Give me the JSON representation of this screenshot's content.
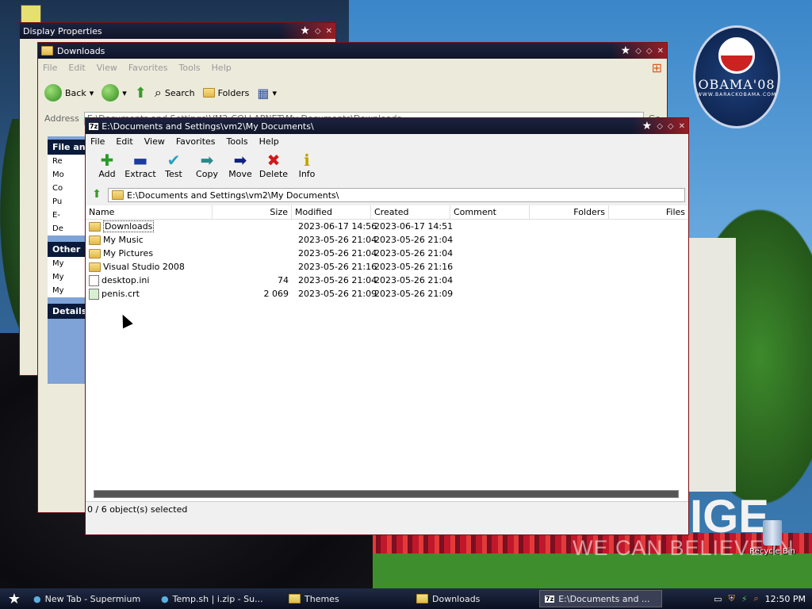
{
  "desktop": {
    "obama_text": "OBAMA'08",
    "obama_sub": "WWW.BARACKOBAMA.COM",
    "change_text": "IGE",
    "believe_text": "WE CAN BELIEVE IN",
    "recycle_label": "Recycle Bin"
  },
  "display_properties": {
    "title": "Display Properties"
  },
  "downloads_window": {
    "title": "Downloads",
    "menu": [
      "File",
      "Edit",
      "View",
      "Favorites",
      "Tools",
      "Help"
    ],
    "toolbar": {
      "back": "Back",
      "search": "Search",
      "folders": "Folders"
    },
    "address_label": "Address",
    "address_value": "E:\\Documents and Settings\\VM2-COLLAPNET\\My Documents\\Downloads",
    "go_label": "Go",
    "side": {
      "file_tasks_title": "File and Folder Tasks",
      "file_tasks": [
        "Re",
        "Mo",
        "Co",
        "Pu",
        "E-",
        "De"
      ],
      "other_title": "Other",
      "other": [
        "My",
        "My",
        "My"
      ],
      "details_title": "Details"
    }
  },
  "zip_window": {
    "title": "E:\\Documents and Settings\\vm2\\My Documents\\",
    "menu": [
      "File",
      "Edit",
      "View",
      "Favorites",
      "Tools",
      "Help"
    ],
    "toolbar": [
      "Add",
      "Extract",
      "Test",
      "Copy",
      "Move",
      "Delete",
      "Info"
    ],
    "path": "E:\\Documents and Settings\\vm2\\My Documents\\",
    "columns": [
      "Name",
      "Size",
      "Modified",
      "Created",
      "Comment",
      "Folders",
      "Files"
    ],
    "rows": [
      {
        "name": "Downloads",
        "size": "",
        "modified": "2023-06-17 14:56",
        "created": "2023-06-17 14:51",
        "type": "folder"
      },
      {
        "name": "My Music",
        "size": "",
        "modified": "2023-05-26 21:04",
        "created": "2023-05-26 21:04",
        "type": "folder"
      },
      {
        "name": "My Pictures",
        "size": "",
        "modified": "2023-05-26 21:04",
        "created": "2023-05-26 21:04",
        "type": "folder"
      },
      {
        "name": "Visual Studio 2008",
        "size": "",
        "modified": "2023-05-26 21:16",
        "created": "2023-05-26 21:16",
        "type": "folder"
      },
      {
        "name": "desktop.ini",
        "size": "74",
        "modified": "2023-05-26 21:04",
        "created": "2023-05-26 21:04",
        "type": "file"
      },
      {
        "name": "penis.crt",
        "size": "2 069",
        "modified": "2023-05-26 21:09",
        "created": "2023-05-26 21:09",
        "type": "file"
      }
    ],
    "status": "0 / 6 object(s) selected"
  },
  "taskbar": {
    "tasks": [
      "New Tab - Supermium",
      "Temp.sh | i.zip - Su...",
      "Themes",
      "Downloads",
      "E:\\Documents and ..."
    ],
    "clock": "12:50 PM"
  }
}
